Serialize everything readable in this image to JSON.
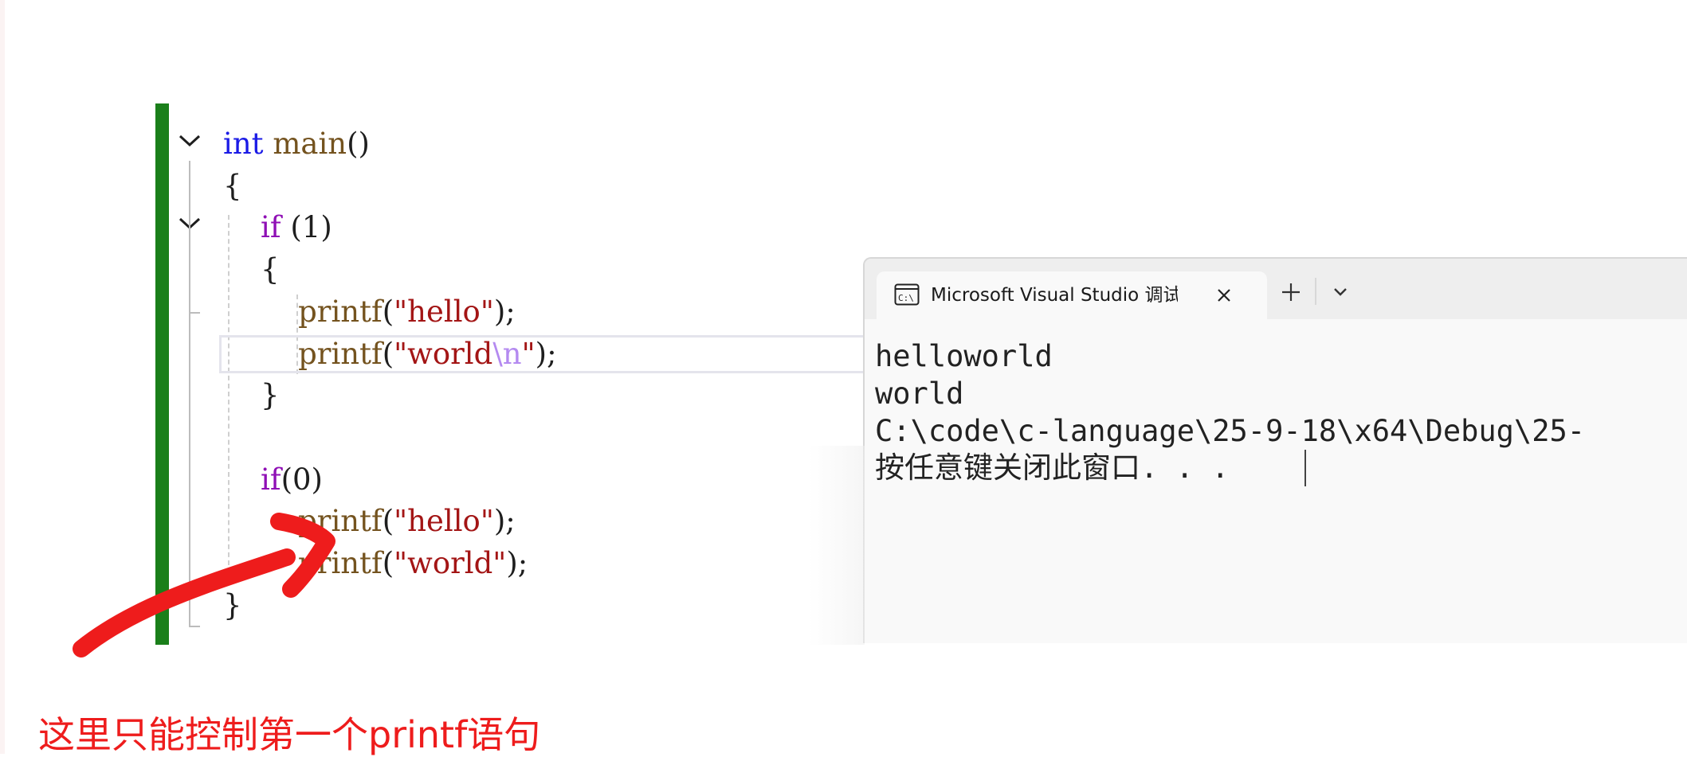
{
  "editor": {
    "lines": [
      [
        {
          "t": "int",
          "c": "kw-type"
        },
        {
          "t": " ",
          "c": "punc"
        },
        {
          "t": "main",
          "c": "fn"
        },
        {
          "t": "()",
          "c": "punc"
        }
      ],
      [
        {
          "t": "{",
          "c": "punc"
        }
      ],
      [
        {
          "t": "    ",
          "c": "punc"
        },
        {
          "t": "if",
          "c": "kw-ctrl"
        },
        {
          "t": " (1)",
          "c": "punc"
        }
      ],
      [
        {
          "t": "    {",
          "c": "punc"
        }
      ],
      [
        {
          "t": "        ",
          "c": "punc"
        },
        {
          "t": "printf",
          "c": "fn"
        },
        {
          "t": "(",
          "c": "punc"
        },
        {
          "t": "\"hello\"",
          "c": "str"
        },
        {
          "t": ");",
          "c": "punc"
        }
      ],
      [
        {
          "t": "        ",
          "c": "punc"
        },
        {
          "t": "printf",
          "c": "fn"
        },
        {
          "t": "(",
          "c": "punc"
        },
        {
          "t": "\"world",
          "c": "str"
        },
        {
          "t": "\\n",
          "c": "esc"
        },
        {
          "t": "\"",
          "c": "str"
        },
        {
          "t": ");",
          "c": "punc"
        }
      ],
      [
        {
          "t": "    }",
          "c": "punc"
        }
      ],
      [],
      [
        {
          "t": "    ",
          "c": "punc"
        },
        {
          "t": "if",
          "c": "kw-ctrl"
        },
        {
          "t": "(0)",
          "c": "punc"
        }
      ],
      [
        {
          "t": "        ",
          "c": "punc"
        },
        {
          "t": "printf",
          "c": "fn"
        },
        {
          "t": "(",
          "c": "punc"
        },
        {
          "t": "\"hello\"",
          "c": "str"
        },
        {
          "t": ");",
          "c": "punc"
        }
      ],
      [
        {
          "t": "        ",
          "c": "punc"
        },
        {
          "t": "printf",
          "c": "fn"
        },
        {
          "t": "(",
          "c": "punc"
        },
        {
          "t": "\"world\"",
          "c": "str"
        },
        {
          "t": ");",
          "c": "punc"
        }
      ],
      [
        {
          "t": "}",
          "c": "punc"
        }
      ]
    ]
  },
  "console": {
    "tab_title": "Microsoft Visual Studio 调试控制台",
    "tab_icon": "console-app-icon",
    "close_icon": "close-icon",
    "add_icon": "plus-icon",
    "dropdown_icon": "chevron-down-icon",
    "output": [
      "helloworld",
      "world",
      "C:\\code\\c-language\\25-9-18\\x64\\Debug\\25-",
      "按任意键关闭此窗口. . ."
    ]
  },
  "annotation": {
    "text": "这里只能控制第一个printf语句",
    "color": "#ee1c1c"
  },
  "colors": {
    "change_bar": "#1a7f1a",
    "keyword_type": "#1b1be6",
    "keyword_control": "#8f0fb5",
    "function": "#74531f",
    "string": "#a31515",
    "escape": "#b48af0"
  }
}
